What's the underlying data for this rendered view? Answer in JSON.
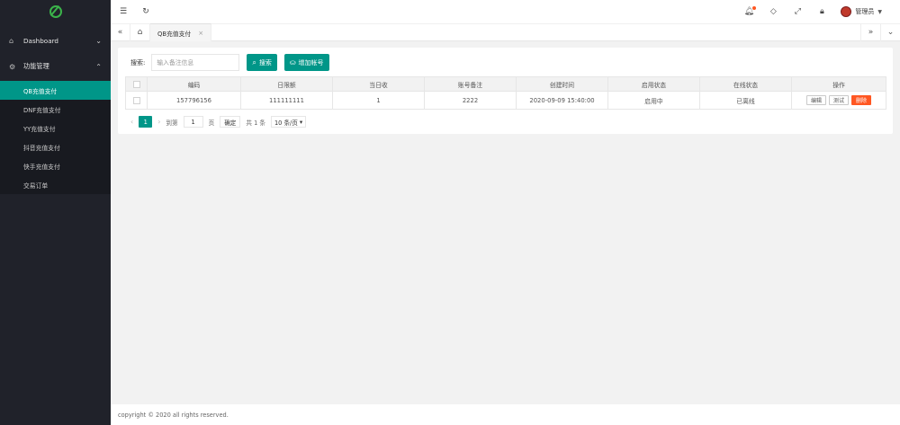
{
  "sidebar": {
    "groups": [
      {
        "label": "Dashboard",
        "icon": "home-icon",
        "chevron": "⌄"
      },
      {
        "label": "功能管理",
        "icon": "gear-icon",
        "chevron": "⌃"
      }
    ],
    "items": [
      {
        "label": "QB充值支付",
        "active": true
      },
      {
        "label": "DNF充值支付"
      },
      {
        "label": "YY充值支付"
      },
      {
        "label": "抖音充值支付"
      },
      {
        "label": "快手充值支付"
      },
      {
        "label": "交易订单"
      }
    ]
  },
  "header": {
    "user_name": "管理员"
  },
  "tabs": [
    {
      "label": "QB充值支付"
    }
  ],
  "search": {
    "label": "搜索:",
    "placeholder": "输入备注信息",
    "search_button": "搜索",
    "add_button": "增加帐号"
  },
  "table": {
    "headers": [
      "编码",
      "日限额",
      "当日收",
      "账号备注",
      "创建时间",
      "启用状态",
      "在线状态",
      "操作"
    ],
    "rows": [
      {
        "code": "157796156",
        "daily_limit": "111111111",
        "today_income": "1",
        "remark": "2222",
        "created": "2020-09-09 15:40:00",
        "enabled": "启用中",
        "online": "已离线",
        "actions": [
          "编辑",
          "测试",
          "删除"
        ]
      }
    ]
  },
  "pager": {
    "current": "1",
    "goto_label": "到第",
    "goto_value": "1",
    "page_unit": "页",
    "confirm": "确定",
    "total": "共 1 条",
    "page_size": "10 条/页"
  },
  "footer": {
    "text": "copyright © 2020 all rights reserved."
  },
  "colors": {
    "accent": "#009688",
    "sidebar_bg": "#20222a",
    "danger": "#ff5722",
    "success": "#5fb878"
  }
}
